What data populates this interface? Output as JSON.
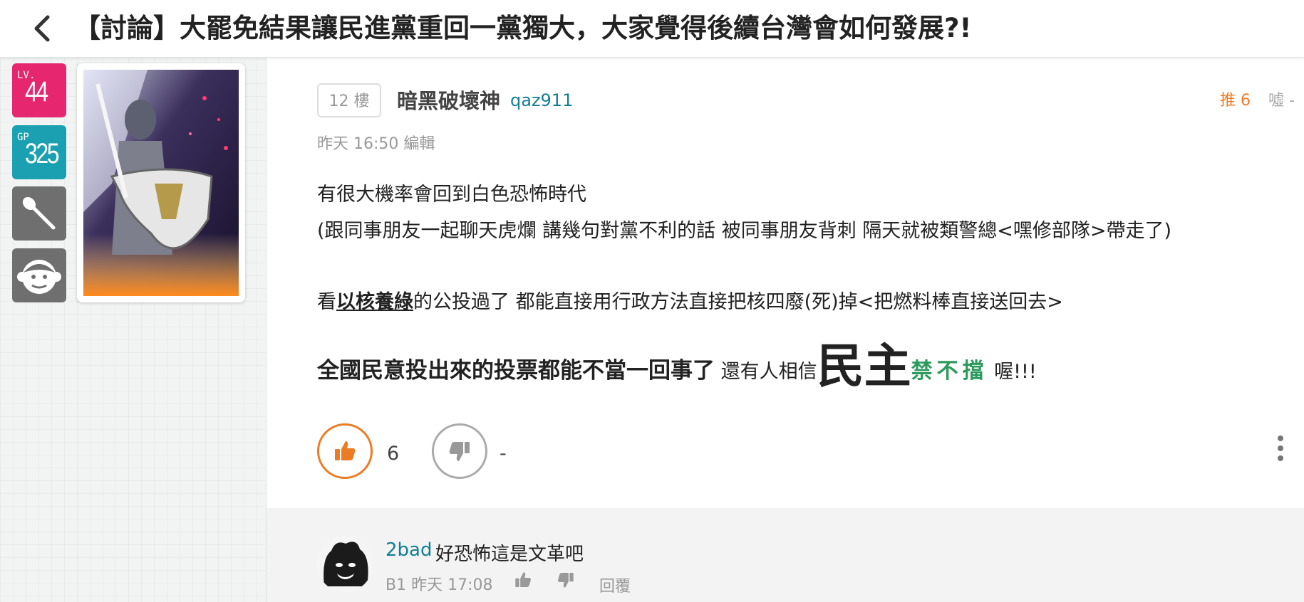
{
  "header": {
    "title": "【討論】大罷免結果讓民進黨重回一黨獨大，大家覺得後續台灣會如何發展?!",
    "back_icon": "chevron-left-icon"
  },
  "sidebar": {
    "level_prefix": "LV.",
    "level": "44",
    "gp_prefix": "GP",
    "gp": "325",
    "wand_icon": "wand-icon",
    "face_icon": "monkey-face-icon"
  },
  "post": {
    "floor": "12 樓",
    "author_name": "暗黑破壞神",
    "author_id": "qaz911",
    "meta": "昨天 16:50 編輯",
    "push_label": "推 6",
    "boo_label": "噓 -",
    "content": {
      "line1": "有很大機率會回到白色恐怖時代",
      "line2": "(跟同事朋友一起聊天虎爛 講幾句對黨不利的話 被同事朋友背刺 隔天就被類警總<嘿修部隊>帶走了)",
      "line3_pre": "看",
      "line3_link": "以核養綠",
      "line3_post": "的公投過了 都能直接用行政方法直接把核四廢(死)掉<把燃料棒直接送回去>",
      "line4_bold": "全國民意投出來的投票都能不當一回事了",
      "line4_mid": " 還有人相信",
      "line4_huge": "民主",
      "line4_green": "禁不擋",
      "line4_end": " 喔!!!"
    },
    "like_count": "6",
    "dislike_count": "-",
    "colors": {
      "push": "#ec7c23",
      "link": "#117e96",
      "green": "#2c9a5c",
      "level": "#e6266e",
      "gp": "#1aa0b0"
    }
  },
  "comment": {
    "user": "2bad",
    "text": "好恐怖這是文革吧",
    "meta": "B1  昨天 17:08",
    "reply_label": "回覆"
  }
}
